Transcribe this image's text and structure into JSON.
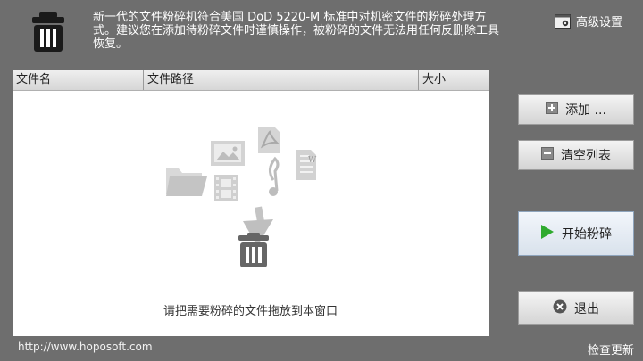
{
  "header": {
    "description": "新一代的文件粉碎机符合美国 DoD 5220-M 标准中对机密文件的粉碎处理方式。建议您在添加待粉碎文件时谨慎操作，被粉碎的文件无法用任何反删除工具恢复。",
    "settings_label": "高级设置"
  },
  "table": {
    "columns": [
      "文件名",
      "文件路径",
      "大小"
    ],
    "drop_hint": "请把需要粉碎的文件拖放到本窗口"
  },
  "buttons": {
    "add": "添加 ...",
    "clear": "清空列表",
    "start": "开始粉碎",
    "exit": "退出"
  },
  "footer": {
    "url": "http://www.hoposoft.com",
    "update": "检查更新"
  },
  "colors": {
    "background": "#6e6e6e",
    "start_icon": "#2eaa2e",
    "panel": "#ffffff"
  },
  "icons": [
    "trash-icon",
    "settings-icon",
    "folder-icon",
    "image-icon",
    "film-icon",
    "pdf-icon",
    "music-icon",
    "document-icon",
    "arrow-down-icon",
    "plus-icon",
    "minus-icon",
    "play-icon",
    "close-circle-icon"
  ]
}
